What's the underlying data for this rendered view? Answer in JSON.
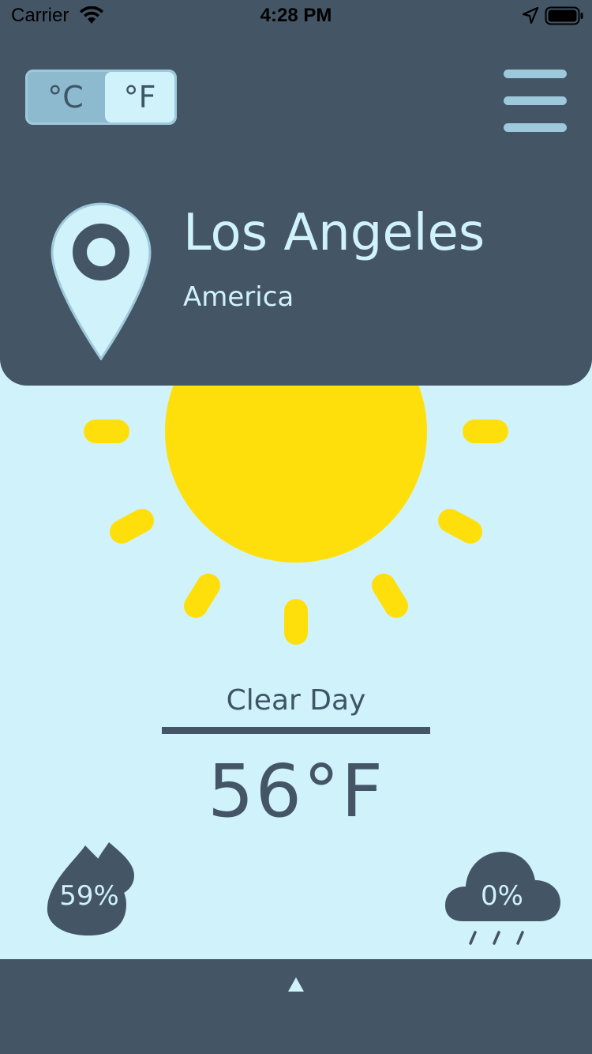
{
  "status_bar": {
    "carrier": "Carrier",
    "time": "4:28 PM",
    "icons": [
      "wifi-icon",
      "location-arrow-icon",
      "battery-icon"
    ]
  },
  "unit_toggle": {
    "celsius_label": "°C",
    "fahrenheit_label": "°F",
    "selected": "°F"
  },
  "header": {
    "city": "Los Angeles",
    "country": "America",
    "menu_icon": "hamburger-menu-icon",
    "location_icon": "map-pin-icon"
  },
  "weather": {
    "icon": "sun-icon",
    "condition": "Clear Day",
    "temperature": "56°F"
  },
  "stats": {
    "humidity": "59%",
    "humidity_icon": "water-drops-icon",
    "precipitation": "0%",
    "precipitation_icon": "rain-cloud-icon"
  },
  "bottom_bar": {
    "icon": "expand-up-arrow-icon"
  },
  "colors": {
    "dark_slate": "#445565",
    "sky_background": "#d0f2fa",
    "sun_yellow": "#ffdf0b",
    "accent_blue": "#9ec9dc"
  }
}
